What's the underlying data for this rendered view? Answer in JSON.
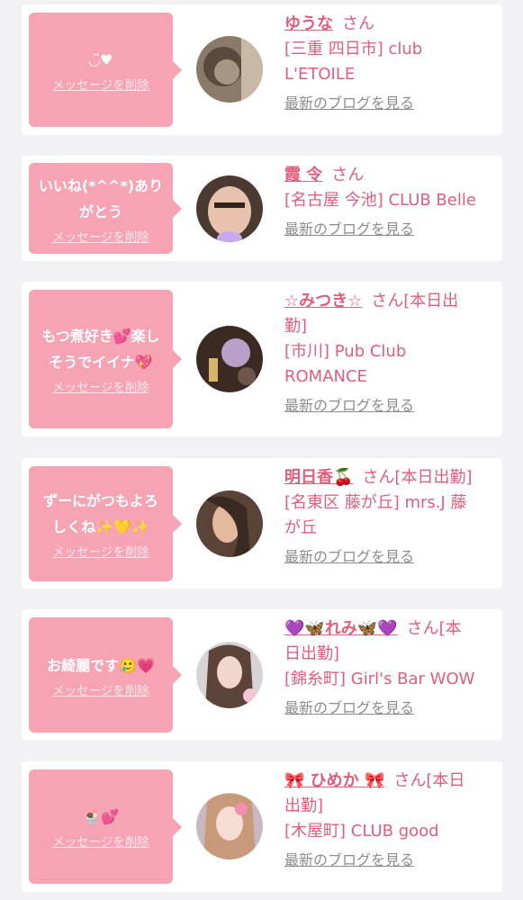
{
  "items": [
    {
      "message_lines": [
        "◡̈♥"
      ],
      "delete_label": "メッセージを削除",
      "name": "ゆうな",
      "san": "さん",
      "shop_lines": [
        "[三重 四日市] club",
        "L'ETOILE"
      ],
      "blog_label": "最新のブログを見る"
    },
    {
      "message_lines": [
        "いいね(*^^*)あり",
        "がとう"
      ],
      "delete_label": "メッセージを削除",
      "name": "霞 令",
      "san": "さん",
      "shop_lines": [
        "[名古屋 今池] CLUB Belle"
      ],
      "blog_label": "最新のブログを見る"
    },
    {
      "message_lines": [
        "もつ煮好き💕楽し",
        "そうでイイナ💖"
      ],
      "delete_label": "メッセージを削除",
      "name": "☆みつき☆",
      "san": "さん[本日出",
      "san2": "勤]",
      "shop_lines": [
        "[市川] Pub Club",
        "ROMANCE"
      ],
      "blog_label": "最新のブログを見る"
    },
    {
      "message_lines": [
        "ずーにがつもよろ",
        "しくね✨💛✨"
      ],
      "delete_label": "メッセージを削除",
      "name": "明日香🍒",
      "san": "さん[本日出勤]",
      "shop_lines": [
        "[名東区 藤が丘] mrs.J 藤",
        "が丘"
      ],
      "blog_label": "最新のブログを見る"
    },
    {
      "message_lines": [
        "お綺麗です🥲💗"
      ],
      "delete_label": "メッセージを削除",
      "name": "💜🦋れみ🦋💜",
      "san": "さん[本",
      "san2": "日出勤]",
      "shop_lines": [
        "[錦糸町] Girl's Bar WOW"
      ],
      "blog_label": "最新のブログを見る"
    },
    {
      "message_lines": [
        "🍨💕"
      ],
      "delete_label": "メッセージを削除",
      "name": "🎀 ひめか 🎀",
      "san": "さん[本日",
      "san2": "出勤]",
      "shop_lines": [
        "[木屋町] CLUB good"
      ],
      "blog_label": "最新のブログを見る"
    }
  ],
  "colors": {
    "accent": "#e25d7c",
    "bubble": "#f6a3b4",
    "background": "#f2f2f4"
  }
}
